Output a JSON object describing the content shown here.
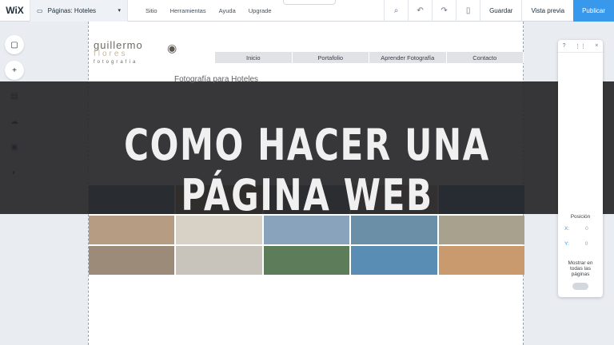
{
  "topbar": {
    "logo": "WiX",
    "page_selector": "Páginas: Hoteles",
    "menu": [
      "Sitio",
      "Herramientas",
      "Ayuda",
      "Upgrade"
    ],
    "save_label": "Guardar",
    "preview_label": "Vista previa",
    "publish_label": "Publicar",
    "icons": [
      "zoom-icon",
      "undo-icon",
      "redo-icon",
      "mobile-icon"
    ]
  },
  "site": {
    "logo_line1": "guillermo",
    "logo_line2": "flores",
    "logo_line3": "fotografía",
    "nav": [
      "Inicio",
      "Portafolio",
      "Aprender Fotografía",
      "Contacto"
    ],
    "page_heading": "Fotografía para Hoteles"
  },
  "overlay": {
    "headline": "COMO HACER UNA PÁGINA WEB"
  },
  "right_panel": {
    "position_label": "Posición",
    "x_label": "X:",
    "x_value": "0",
    "y_label": "Y:",
    "y_value": "0",
    "show_all_label": "Mostrar en todas las páginas"
  }
}
